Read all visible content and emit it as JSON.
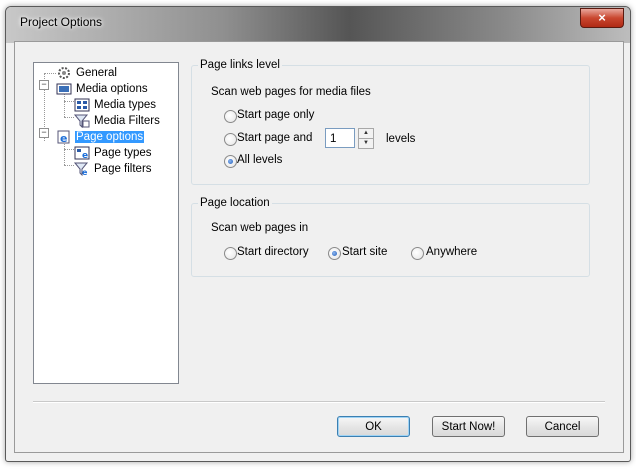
{
  "window": {
    "title": "Project Options",
    "close_symbol": "×"
  },
  "tree": {
    "items": [
      {
        "label": "General",
        "icon": "gear-icon"
      },
      {
        "label": "Media options",
        "icon": "media-icon"
      },
      {
        "label": "Media types",
        "icon": "media-types-icon"
      },
      {
        "label": "Media Filters",
        "icon": "filter-icon"
      },
      {
        "label": "Page options",
        "icon": "ie-page-icon",
        "selected": true
      },
      {
        "label": "Page types",
        "icon": "page-types-icon"
      },
      {
        "label": "Page filters",
        "icon": "page-filter-icon"
      }
    ],
    "expander_symbol": "−"
  },
  "links_group": {
    "title": "Page links level",
    "caption": "Scan web pages for media files",
    "options": [
      "Start page only",
      "Start page and",
      "All levels"
    ],
    "selected_index": 2,
    "levels_value": "1",
    "levels_suffix": "levels"
  },
  "location_group": {
    "title": "Page location",
    "caption": "Scan web pages in",
    "options": [
      "Start directory",
      "Start site",
      "Anywhere"
    ],
    "selected_index": 1
  },
  "buttons": {
    "ok": "OK",
    "start_now": "Start Now!",
    "cancel": "Cancel"
  },
  "colors": {
    "selection": "#3399ff",
    "default_button_border": "#3c7fb1"
  }
}
